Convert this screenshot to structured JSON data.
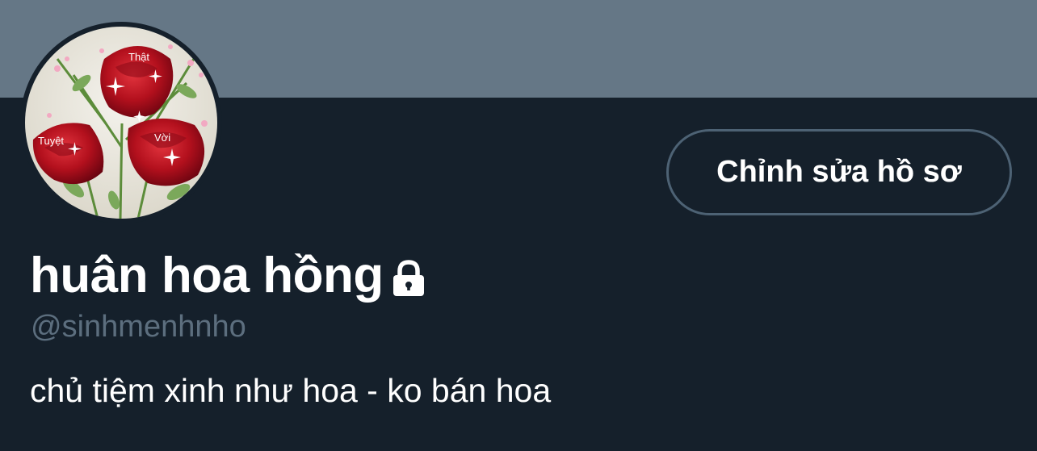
{
  "profile": {
    "display_name": "huân hoa hồng",
    "handle": "@sinhmenhnho",
    "bio": "chủ tiệm xinh như hoa - ko bán hoa",
    "protected_icon": "lock-icon",
    "avatar": {
      "labels": [
        "Thật",
        "Tuyệt",
        "Vời"
      ]
    }
  },
  "actions": {
    "edit_profile_label": "Chỉnh sửa hồ sơ"
  },
  "colors": {
    "banner": "#657786",
    "background": "#15202b",
    "handle_text": "#5c6e7e",
    "button_border": "#4d6274"
  }
}
